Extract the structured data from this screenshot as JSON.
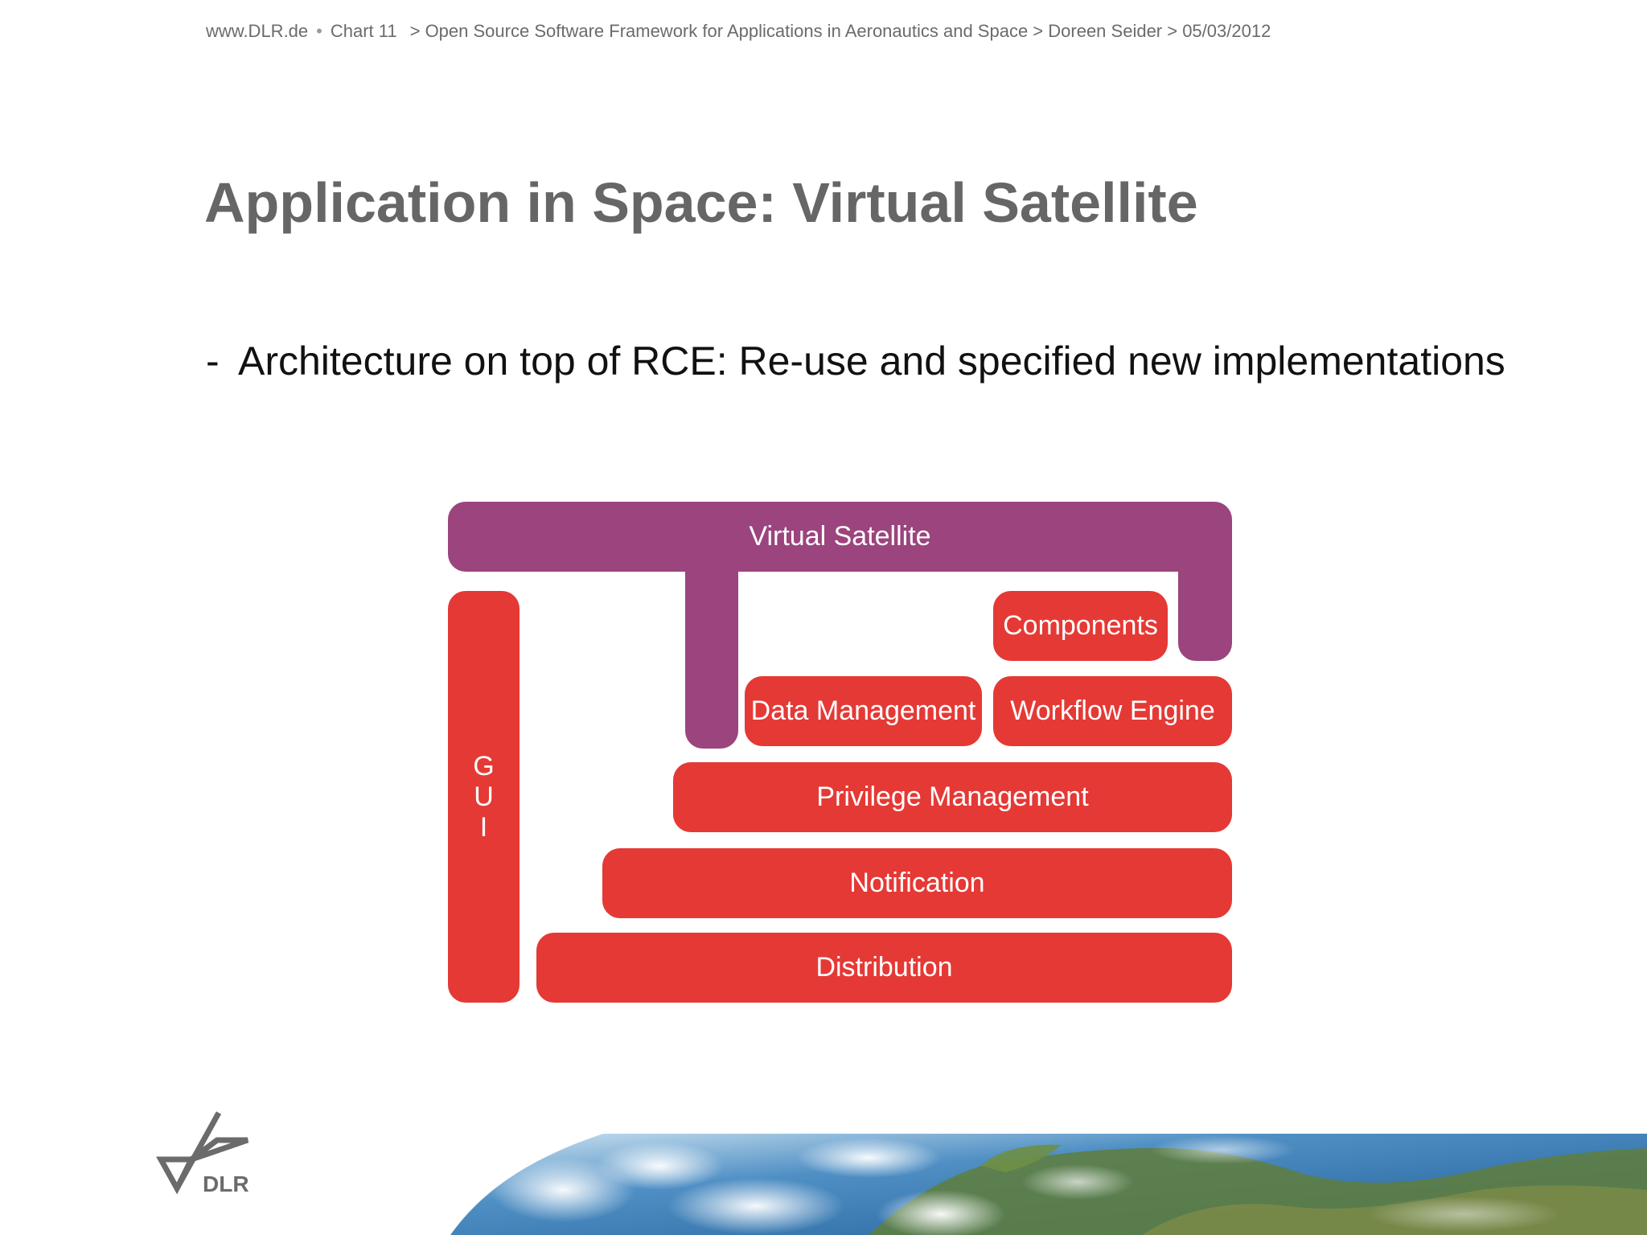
{
  "header": {
    "site": "www.DLR.de",
    "bullet_sep": "•",
    "chart": "Chart 11",
    "breadcrumb": "> Open Source Software Framework for Applications in Aeronautics and Space > Doreen Seider > 05/03/2012"
  },
  "title": "Application in Space: Virtual Satellite",
  "bullet": {
    "dash": "-",
    "text": "Architecture on top of RCE: Re-use and specified new implementations"
  },
  "diagram": {
    "virtual_satellite": "Virtual Satellite",
    "gui_letters": [
      "G",
      "U",
      "I"
    ],
    "components": "Components",
    "data_management": "Data Management",
    "workflow_engine": "Workflow Engine",
    "privilege_management": "Privilege Management",
    "notification": "Notification",
    "distribution": "Distribution",
    "colors": {
      "purple": "#9b447d",
      "red": "#e53935"
    }
  },
  "logo": {
    "text": "DLR",
    "icon": "dlr-logo-icon"
  }
}
